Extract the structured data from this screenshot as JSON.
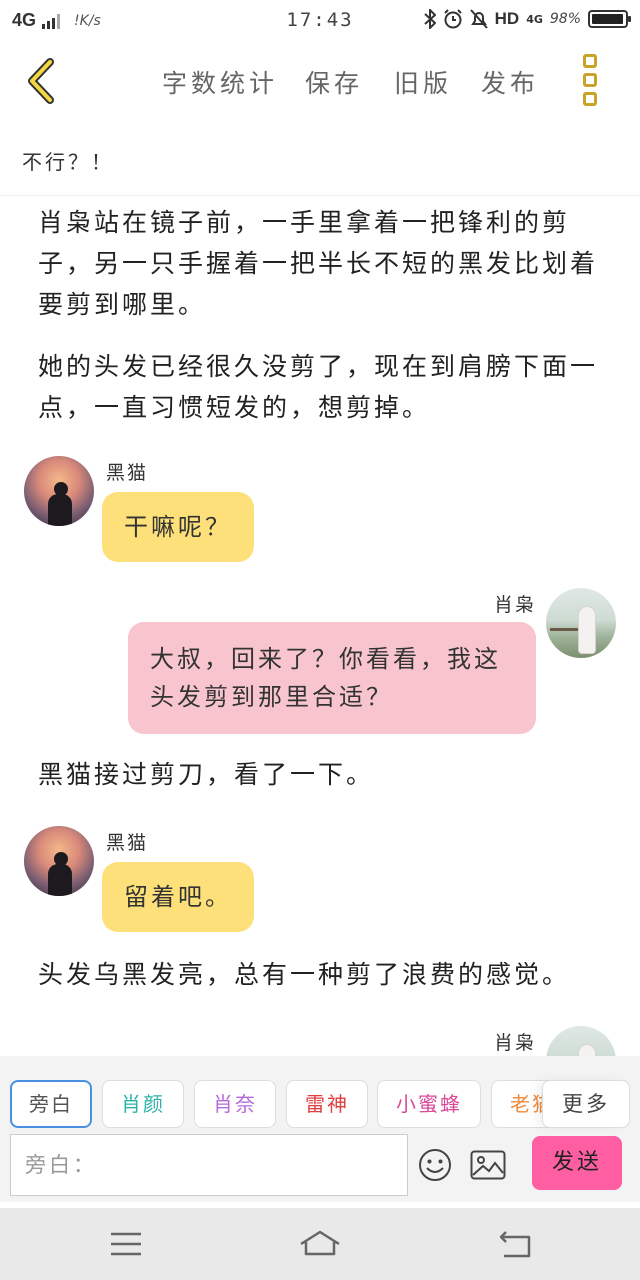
{
  "status_bar": {
    "network": "4G",
    "speed": "!K/s",
    "time": "17:43",
    "hd": "HD",
    "lte": "4G",
    "battery_percent_text": "98%",
    "battery_level": 0.98,
    "icons": [
      "signal-icon",
      "bluetooth-icon",
      "alarm-icon",
      "silent-icon",
      "battery-icon"
    ]
  },
  "toolbar": {
    "back_icon": "chevron-left-icon",
    "word_count": "字数统计",
    "save": "保存",
    "old_version": "旧版",
    "publish": "发布",
    "menu_icon": "vertical-dots-icon",
    "accent": "#c9a227"
  },
  "title": "不行？！",
  "content": {
    "narration_1": "肖枭站在镜子前，一手里拿着一把锋利的剪子，另一只手握着一把半长不短的黑发比划着要剪到哪里。",
    "narration_2": "她的头发已经很久没剪了，现在到肩膀下面一点，一直习惯短发的，想剪掉。",
    "msg_1": {
      "speaker": "黑猫",
      "text": "干嘛呢？"
    },
    "msg_2": {
      "speaker": "肖枭",
      "text": "大叔，回来了？你看看，我这头发剪到那里合适？"
    },
    "narration_3": "黑猫接过剪刀，看了一下。",
    "msg_3": {
      "speaker": "黑猫",
      "text": "留着吧。"
    },
    "narration_4": "头发乌黑发亮，总有一种剪了浪费的感觉。",
    "msg_4": {
      "speaker": "肖枭"
    }
  },
  "role_bar": {
    "roles": [
      {
        "label": "旁白",
        "color": "#555555"
      },
      {
        "label": "肖颜",
        "color": "#2bb3a8"
      },
      {
        "label": "肖奈",
        "color": "#b46ad8"
      },
      {
        "label": "雷神",
        "color": "#e04040"
      },
      {
        "label": "小蜜蜂",
        "color": "#d84a9a"
      },
      {
        "label": "老猫",
        "color": "#f08a3a"
      }
    ],
    "more": "更多",
    "input_placeholder": "旁白：",
    "emoji_icon": "emoji-icon",
    "image_icon": "image-icon",
    "send": "发送",
    "send_color": "#ff5fa2"
  },
  "nav_bar": {
    "icons": [
      "menu-icon",
      "home-icon",
      "back-icon"
    ]
  }
}
